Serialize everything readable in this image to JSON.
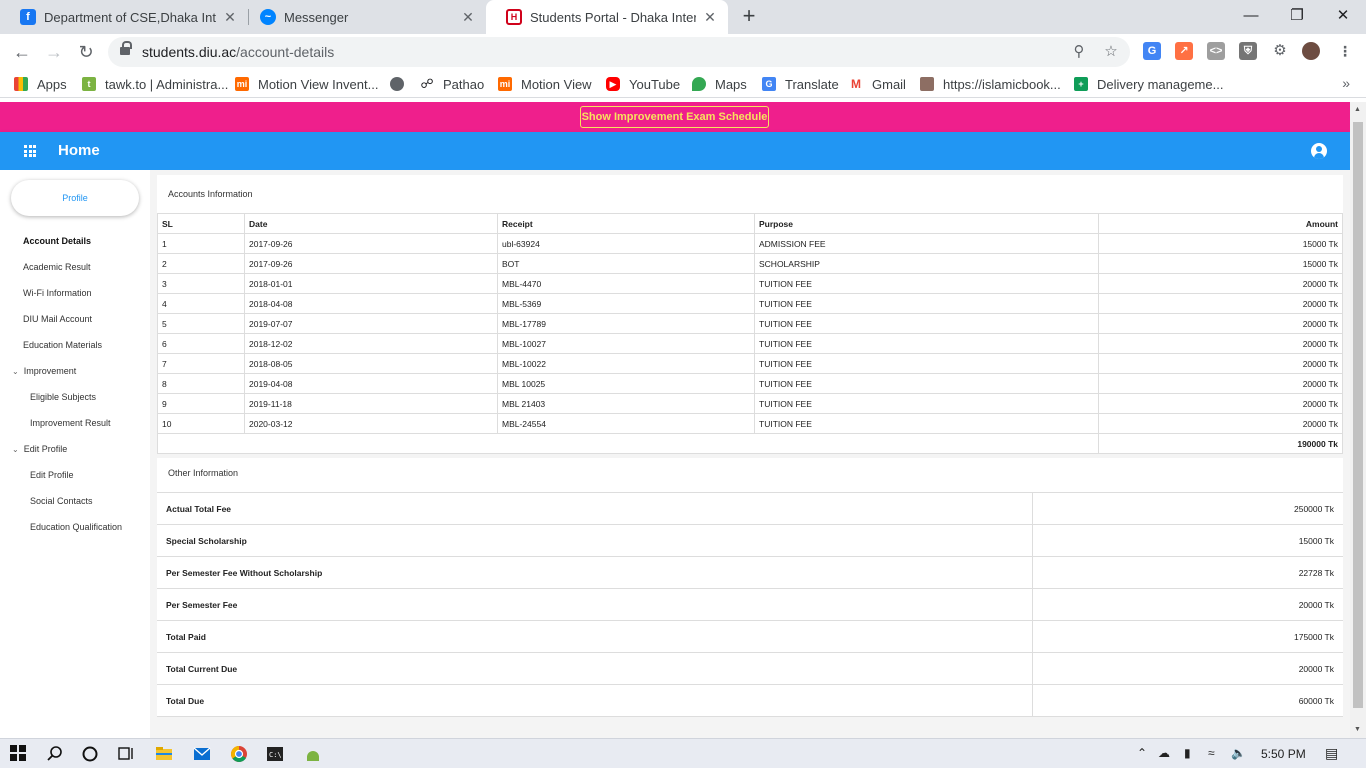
{
  "browser": {
    "tabs": [
      {
        "title": "Department of CSE,Dhaka Interna",
        "icon": "facebook-icon",
        "color": "#1877f2"
      },
      {
        "title": "Messenger",
        "icon": "messenger-icon",
        "color": "#0084ff"
      },
      {
        "title": "Students Portal - Dhaka Internatio",
        "icon": "diu-icon",
        "color": "#d0021b"
      }
    ],
    "url_host": "students.diu.ac",
    "url_path": "/account-details",
    "bookmarks": [
      {
        "label": "Apps",
        "icon": "apps-grid-icon",
        "color": "#ea4335"
      },
      {
        "label": "tawk.to | Administra...",
        "icon": "tawk-icon",
        "color": "#7cb342"
      },
      {
        "label": "Motion View Invent...",
        "icon": "mi-icon",
        "color": "#ff6900"
      },
      {
        "label": "",
        "icon": "globe-icon",
        "color": "#5f6368"
      },
      {
        "label": "Pathao",
        "icon": "bicycle-icon",
        "color": "#202124"
      },
      {
        "label": "Motion View",
        "icon": "mi-icon",
        "color": "#ff6900"
      },
      {
        "label": "YouTube",
        "icon": "youtube-icon",
        "color": "#ff0000"
      },
      {
        "label": "Maps",
        "icon": "maps-pin-icon",
        "color": "#34a853"
      },
      {
        "label": "Translate",
        "icon": "translate-icon",
        "color": "#4285f4"
      },
      {
        "label": "Gmail",
        "icon": "gmail-icon",
        "color": "#ea4335"
      },
      {
        "label": "https://islamicbook...",
        "icon": "book-icon",
        "color": "#8d6e63"
      },
      {
        "label": "Delivery manageme...",
        "icon": "sheets-icon",
        "color": "#0f9d58"
      }
    ]
  },
  "page": {
    "notice_button": "Show Improvement Exam Schedule",
    "header_title": "Home",
    "colors": {
      "notice_bg": "#ef1f8c",
      "header_bg": "#2196f3",
      "notice_text": "#f7e35d"
    }
  },
  "sidebar": {
    "profile_button": "Profile",
    "items": [
      {
        "label": "Account Details",
        "active": true
      },
      {
        "label": "Academic Result"
      },
      {
        "label": "Wi-Fi Information"
      },
      {
        "label": "DIU Mail Account"
      },
      {
        "label": "Education Materials"
      },
      {
        "label": "Improvement",
        "group": true
      },
      {
        "label": "Eligible Subjects",
        "sub": true
      },
      {
        "label": "Improvement Result",
        "sub": true
      },
      {
        "label": "Edit Profile",
        "group": true
      },
      {
        "label": "Edit Profile",
        "sub": true
      },
      {
        "label": "Social Contacts",
        "sub": true
      },
      {
        "label": "Education Qualification",
        "sub": true
      }
    ]
  },
  "accounts": {
    "title": "Accounts Information",
    "columns": [
      "SL",
      "Date",
      "Receipt",
      "Purpose",
      "Amount"
    ],
    "rows": [
      [
        "1",
        "2017-09-26",
        "ubl-63924",
        "ADMISSION FEE",
        "15000 Tk"
      ],
      [
        "2",
        "2017-09-26",
        "BOT",
        "SCHOLARSHIP",
        "15000 Tk"
      ],
      [
        "3",
        "2018-01-01",
        "MBL-4470",
        "TUITION FEE",
        "20000 Tk"
      ],
      [
        "4",
        "2018-04-08",
        "MBL-5369",
        "TUITION FEE",
        "20000 Tk"
      ],
      [
        "5",
        "2019-07-07",
        "MBL-17789",
        "TUITION FEE",
        "20000 Tk"
      ],
      [
        "6",
        "2018-12-02",
        "MBL-10027",
        "TUITION FEE",
        "20000 Tk"
      ],
      [
        "7",
        "2018-08-05",
        "MBL-10022",
        "TUITION FEE",
        "20000 Tk"
      ],
      [
        "8",
        "2019-04-08",
        "MBL 10025",
        "TUITION FEE",
        "20000 Tk"
      ],
      [
        "9",
        "2019-11-18",
        "MBL 21403",
        "TUITION FEE",
        "20000 Tk"
      ],
      [
        "10",
        "2020-03-12",
        "MBL-24554",
        "TUITION FEE",
        "20000 Tk"
      ]
    ],
    "total": "190000 Tk"
  },
  "other": {
    "title": "Other Information",
    "rows": [
      [
        "Actual Total Fee",
        "250000 Tk"
      ],
      [
        "Special Scholarship",
        "15000 Tk"
      ],
      [
        "Per Semester Fee Without Scholarship",
        "22728 Tk"
      ],
      [
        "Per Semester Fee",
        "20000 Tk"
      ],
      [
        "Total Paid",
        "175000 Tk"
      ],
      [
        "Total Current Due",
        "20000 Tk"
      ],
      [
        "Total Due",
        "60000 Tk"
      ]
    ]
  },
  "taskbar": {
    "time": "5:50 PM"
  }
}
